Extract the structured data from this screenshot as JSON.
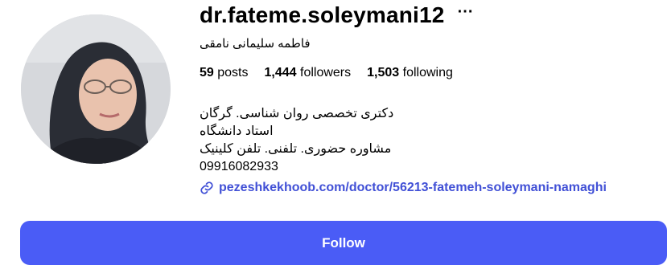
{
  "profile": {
    "username": "dr.fateme.soleymani12",
    "more_label": "···",
    "full_name": "فاطمه سلیمانی نامقی",
    "stats": {
      "posts_count": "59",
      "posts_label": "posts",
      "followers_count": "1,444",
      "followers_label": "followers",
      "following_count": "1,503",
      "following_label": "following"
    },
    "bio": [
      "دکتری تخصصی روان شناسی. گرگان",
      "استاد دانشگاه",
      "مشاوره حضوری. تلفنی. تلفن کلینیک",
      "09916082933"
    ],
    "link_text": "pezeshkekhoob.com/doctor/56213-fatemeh-soleymani-namaghi",
    "follow_label": "Follow"
  },
  "colors": {
    "accent": "#4a5cf6",
    "link": "#4150d6"
  },
  "icons": {
    "link": "link-icon",
    "more": "more-options-icon"
  }
}
